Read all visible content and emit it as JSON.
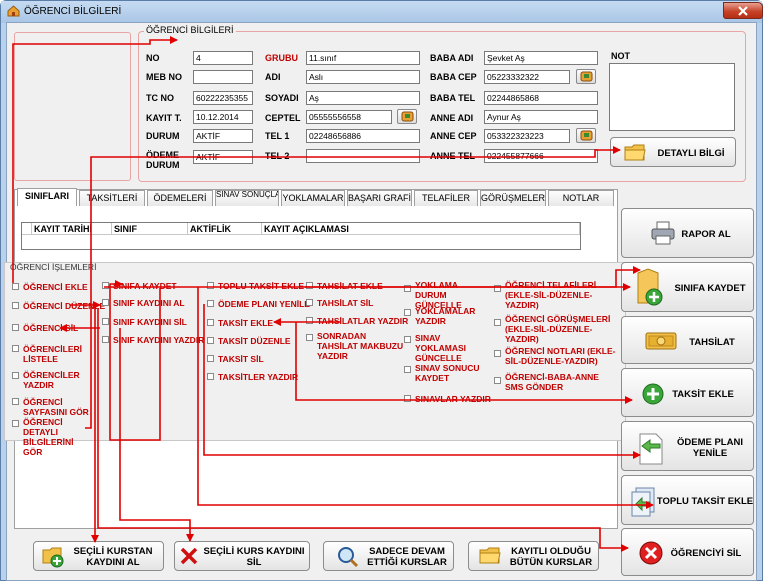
{
  "window": {
    "title": "ÖĞRENCİ BİLGİLERİ"
  },
  "info_group": {
    "title": "ÖĞRENCİ BİLGİLERİ"
  },
  "fields": {
    "no": {
      "label": "NO",
      "value": "4"
    },
    "meb_no": {
      "label": "MEB NO",
      "value": ""
    },
    "tc_no": {
      "label": "TC NO",
      "value": "60222235355"
    },
    "kayit_t": {
      "label": "KAYIT T.",
      "value": "10.12.2014"
    },
    "durum": {
      "label": "DURUM",
      "value": "AKTİF"
    },
    "odeme_durum": {
      "label": "ÖDEME DURUM",
      "value": "AKTİF"
    },
    "grubu": {
      "label": "GRUBU",
      "value": "11.sınıf"
    },
    "adi": {
      "label": "ADI",
      "value": "Aslı"
    },
    "soyadi": {
      "label": "SOYADI",
      "value": "Aş"
    },
    "ceptel": {
      "label": "CEPTEL",
      "value": "05555556558"
    },
    "tel1": {
      "label": "TEL 1",
      "value": "02248656886"
    },
    "tel2": {
      "label": "TEL 2",
      "value": ""
    },
    "baba_adi": {
      "label": "BABA ADI",
      "value": "Şevket Aş"
    },
    "baba_cep": {
      "label": "BABA CEP",
      "value": "05223332322"
    },
    "baba_tel": {
      "label": "BABA TEL",
      "value": "02244865868"
    },
    "anne_adi": {
      "label": "ANNE ADI",
      "value": "Aynur Aş"
    },
    "anne_cep": {
      "label": "ANNE CEP",
      "value": "053322323223"
    },
    "anne_tel": {
      "label": "ANNE TEL",
      "value": "022455877666"
    },
    "not": {
      "label": "NOT",
      "value": ""
    }
  },
  "buttons": {
    "detayli_bilgi": "DETAYLI BİLGİ",
    "rapor_al": "RAPOR AL",
    "sinifa_kaydet": "SINIFA KAYDET",
    "tahsilat": "TAHSİLAT",
    "taksit_ekle": "TAKSİT EKLE",
    "odeme_plani_1": "ÖDEME PLANI",
    "odeme_plani_2": "YENİLE",
    "toplu_taksit_ekle": "TOPLU TAKSİT EKLE",
    "ogrenciyi_sil": "ÖĞRENCİYİ SİL",
    "secili_kurstan_1": "SEÇİLİ KURSTAN",
    "secili_kurstan_2": "KAYDINI AL",
    "secili_kurs_sil_1": "SEÇİLİ KURS KAYDINI",
    "secili_kurs_sil_2": "SİL",
    "devam_1": "SADECE DEVAM",
    "devam_2": "ETTİĞİ KURSLAR",
    "kayitli_1": "KAYITLI OLDUĞU",
    "kayitli_2": "BÜTÜN KURSLAR"
  },
  "tabs": [
    "SINIFLARI",
    "TAKSİTLERİ",
    "ÖDEMELERİ",
    "SINAV SONUÇLARI",
    "YOKLAMALAR",
    "BAŞARI GRAFİĞİ",
    "TELAFİLER",
    "GÖRÜŞMELER",
    "NOTLAR"
  ],
  "grid": {
    "columns": [
      "KAYIT TARİHİ",
      "SINIF",
      "AKTİFLİK",
      "KAYIT AÇIKLAMASI"
    ]
  },
  "operations": {
    "title": "ÖĞRENCİ İŞLEMLERİ",
    "col1": [
      "ÖĞRENCİ EKLE",
      "ÖĞRENCİ DÜZENLE",
      "ÖĞRENCİ SİL",
      "ÖĞRENCİLERİ LİSTELE",
      "ÖĞRENCİLER YAZDIR",
      "ÖĞRENCİ SAYFASINI GÖR",
      "ÖĞRENCİ DETAYLI BİLGİLERİNİ GÖR"
    ],
    "col2": [
      "SINIFA KAYDET",
      "SINIF KAYDINI AL",
      "SINIF KAYDINI SİL",
      "SINIF KAYDINI YAZDIR"
    ],
    "col3": [
      "TOPLU TAKSİT EKLE",
      "ÖDEME PLANI YENİLE",
      "TAKSİT EKLE",
      "TAKSİT DÜZENLE",
      "TAKSİT SİL",
      "TAKSİTLER YAZDIR"
    ],
    "col4": [
      "TAHSİLAT EKLE",
      "TAHSİLAT SİL",
      "TAHSİLATLAR YAZDIR",
      "SONRADAN TAHSİLAT MAKBUZU YAZDIR"
    ],
    "col5": [
      "YOKLAMA DURUM GÜNCELLE",
      "YOKLAMALAR YAZDIR",
      "SINAV YOKLAMASI GÜNCELLE",
      "SINAV SONUCU KAYDET",
      "SINAVLAR YAZDIR"
    ],
    "col6": [
      "ÖĞRENCİ TELAFİLERİ (EKLE-SİL-DÜZENLE-YAZDIR)",
      "ÖĞRENCİ GÖRÜŞMELERİ (EKLE-SİL-DÜZENLE-YAZDIR)",
      "ÖĞRENCİ NOTLARI (EKLE-SİL-DÜZENLE-YAZDIR)",
      "ÖĞRENCİ-BABA-ANNE SMS GÖNDER"
    ]
  },
  "colors": {
    "accent_red": "#c00000",
    "arrow_red": "#e00000",
    "window_frame": "#b9d1ea"
  }
}
